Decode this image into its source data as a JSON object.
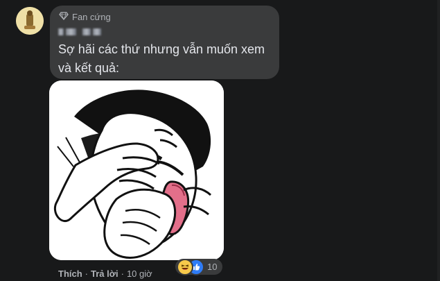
{
  "comment": {
    "badge": "Fan cứng",
    "badge_icon": "diamond-icon",
    "text": "Sợ hãi các thứ nhưng vẫn muốn xem\nvà kết quả:",
    "image_icon": "meme-face-palm-icon",
    "colors": {
      "bubble": "#3a3b3c",
      "text": "#e4e6eb",
      "muted": "#b0b3b8",
      "avatar": "#efe0a7",
      "like": "#2f7cf6",
      "haha": "#f7c94b"
    }
  },
  "actions": {
    "like_label": "Thích",
    "reply_label": "Trả lời",
    "time": "10 giờ",
    "separator": "·"
  },
  "reactions": {
    "icons": [
      "haha-icon",
      "like-icon"
    ],
    "count": "10"
  }
}
